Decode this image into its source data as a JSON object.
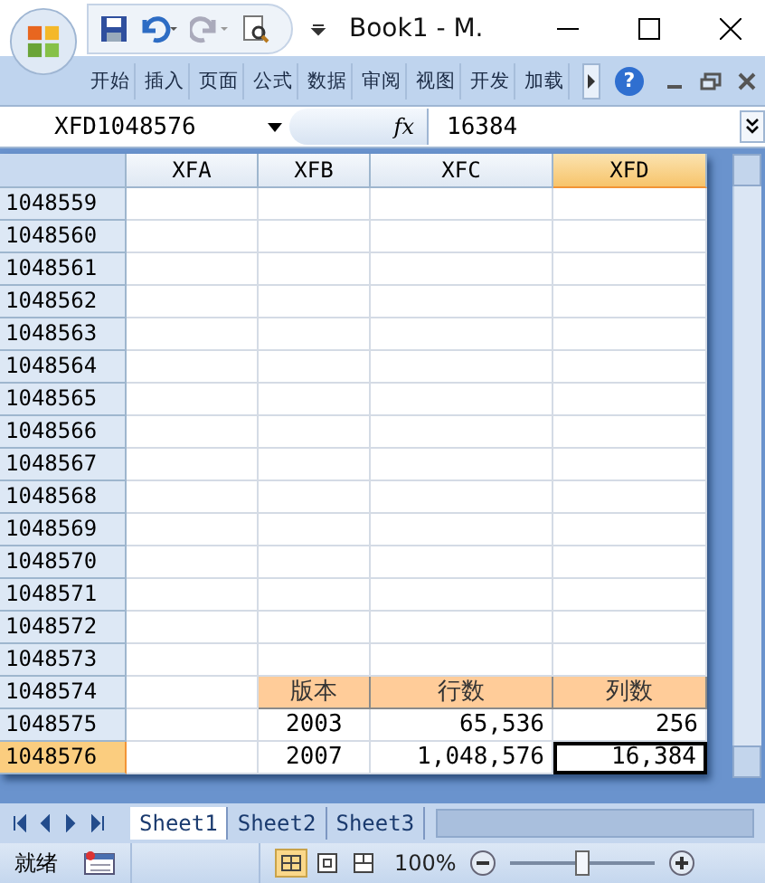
{
  "window": {
    "title": "Book1 - M."
  },
  "ribbon_tabs": [
    {
      "label": "开始",
      "selected": false
    },
    {
      "label": "插入",
      "selected": false
    },
    {
      "label": "页面",
      "selected": false
    },
    {
      "label": "公式",
      "selected": false
    },
    {
      "label": "数据",
      "selected": false
    },
    {
      "label": "审阅",
      "selected": false
    },
    {
      "label": "视图",
      "selected": false
    },
    {
      "label": "开发",
      "selected": false
    },
    {
      "label": "加载",
      "selected": false
    }
  ],
  "help": "?",
  "formula_bar": {
    "name_box": "XFD1048576",
    "fx": "fx",
    "value": "16384"
  },
  "sheet": {
    "columns": [
      {
        "label": "XFA",
        "selected": false
      },
      {
        "label": "XFB",
        "selected": false
      },
      {
        "label": "XFC",
        "selected": false
      },
      {
        "label": "XFD",
        "selected": true
      }
    ],
    "rows": [
      {
        "header": "1048559",
        "selected": false,
        "cells": []
      },
      {
        "header": "1048560",
        "selected": false,
        "cells": []
      },
      {
        "header": "1048561",
        "selected": false,
        "cells": []
      },
      {
        "header": "1048562",
        "selected": false,
        "cells": []
      },
      {
        "header": "1048563",
        "selected": false,
        "cells": []
      },
      {
        "header": "1048564",
        "selected": false,
        "cells": []
      },
      {
        "header": "1048565",
        "selected": false,
        "cells": []
      },
      {
        "header": "1048566",
        "selected": false,
        "cells": []
      },
      {
        "header": "1048567",
        "selected": false,
        "cells": []
      },
      {
        "header": "1048568",
        "selected": false,
        "cells": []
      },
      {
        "header": "1048569",
        "selected": false,
        "cells": []
      },
      {
        "header": "1048570",
        "selected": false,
        "cells": []
      },
      {
        "header": "1048571",
        "selected": false,
        "cells": []
      },
      {
        "header": "1048572",
        "selected": false,
        "cells": []
      },
      {
        "header": "1048573",
        "selected": false,
        "cells": []
      },
      {
        "header": "1048574",
        "selected": false,
        "kind": "heading",
        "cells": [
          {
            "text": "",
            "active": false
          },
          {
            "text": "版本",
            "active": false
          },
          {
            "text": "行数",
            "active": false
          },
          {
            "text": "列数",
            "active": false
          }
        ]
      },
      {
        "header": "1048575",
        "selected": false,
        "kind": "number",
        "cells": [
          {
            "text": "",
            "active": false
          },
          {
            "text": "2003",
            "active": false
          },
          {
            "text": "65,536",
            "active": false
          },
          {
            "text": "256",
            "active": false
          }
        ]
      },
      {
        "header": "1048576",
        "selected": true,
        "kind": "number",
        "cells": [
          {
            "text": "",
            "active": false
          },
          {
            "text": "2007",
            "active": false
          },
          {
            "text": "1,048,576",
            "active": false
          },
          {
            "text": "16,384",
            "active": true
          }
        ]
      }
    ]
  },
  "sheet_tabs": [
    {
      "label": "Sheet1",
      "selected": true
    },
    {
      "label": "Sheet2",
      "selected": false
    },
    {
      "label": "Sheet3",
      "selected": false
    }
  ],
  "status_bar": {
    "status": "就绪",
    "zoom": "100%",
    "zoom_slider": {
      "level": 0.5
    }
  }
}
